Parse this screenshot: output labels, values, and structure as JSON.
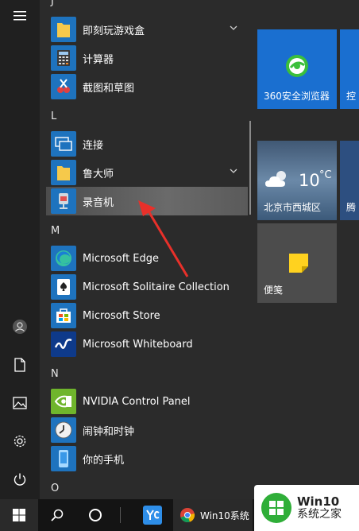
{
  "sections": {
    "j": "J",
    "l": "L",
    "m": "M",
    "n": "N",
    "o": "O"
  },
  "apps": {
    "jike": "即刻玩游戏盒",
    "calculator": "计算器",
    "snip": "截图和草图",
    "connect": "连接",
    "ludashi": "鲁大师",
    "recorder": "录音机",
    "edge": "Microsoft Edge",
    "solitaire": "Microsoft Solitaire Collection",
    "store": "Microsoft Store",
    "whiteboard": "Microsoft Whiteboard",
    "nvidia": "NVIDIA Control Panel",
    "clock": "闹钟和时钟",
    "phone": "你的手机"
  },
  "tiles": {
    "browser": "360安全浏览器",
    "control_partial": "控",
    "weather_temp": "10",
    "weather_unit": "°C",
    "weather_loc": "北京市西城区",
    "tencent_partial": "腾",
    "notes": "便笺"
  },
  "taskbar": {
    "chrome_window": "Win10系统",
    "watermark_title": "Win10",
    "watermark_sub": "系统之家"
  },
  "colors": {
    "accent": "#0078d7",
    "selected_bg": "#5a5a5a",
    "annotation_arrow": "#e8302a"
  }
}
